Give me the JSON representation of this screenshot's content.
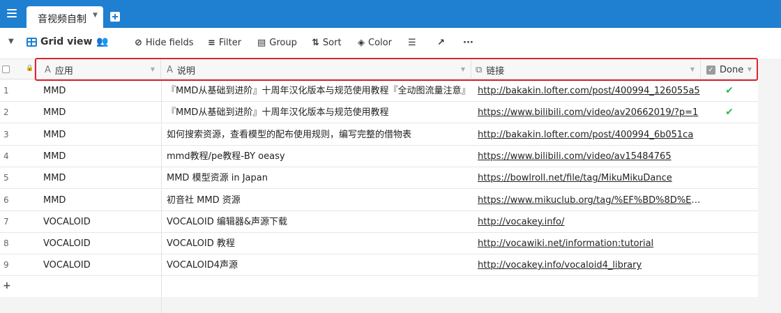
{
  "tab": {
    "title": "音视频自制"
  },
  "toolbar": {
    "view_name": "Grid view",
    "hide_fields": "Hide fields",
    "filter": "Filter",
    "group": "Group",
    "sort": "Sort",
    "color": "Color",
    "more": "···"
  },
  "columns": {
    "app": "应用",
    "desc": "说明",
    "link": "链接",
    "done": "Done"
  },
  "rows": [
    {
      "n": "1",
      "app": "MMD",
      "desc": "『MMD从基础到进阶』十周年汉化版本与规范使用教程『全动图流量注意』",
      "url": "http://bakakin.lofter.com/post/400994_126055a5",
      "done": "✔"
    },
    {
      "n": "2",
      "app": "MMD",
      "desc": "『MMD从基础到进阶』十周年汉化版本与规范使用教程",
      "url": "https://www.bilibili.com/video/av20662019/?p=1",
      "done": "✔"
    },
    {
      "n": "3",
      "app": "MMD",
      "desc": "如何搜索资源，查看模型的配布使用规则，编写完整的借物表",
      "url": "http://bakakin.lofter.com/post/400994_6b051ca",
      "done": ""
    },
    {
      "n": "4",
      "app": "MMD",
      "desc": "mmd教程/pe教程-BY oeasy",
      "url": "https://www.bilibili.com/video/av15484765",
      "done": ""
    },
    {
      "n": "5",
      "app": "MMD",
      "desc": "MMD 模型资源 in Japan",
      "url": "https://bowlroll.net/file/tag/MikuMikuDance",
      "done": ""
    },
    {
      "n": "6",
      "app": "MMD",
      "desc": "初音社 MMD 资源",
      "url": "https://www.mikuclub.org/tag/%EF%BD%8D%EF%BD...",
      "done": ""
    },
    {
      "n": "7",
      "app": "VOCALOID",
      "desc": "VOCALOID 编辑器&声源下载",
      "url": "http://vocakey.info/",
      "done": ""
    },
    {
      "n": "8",
      "app": "VOCALOID",
      "desc": "VOCALOID 教程",
      "url": "http://vocawiki.net/information:tutorial",
      "done": ""
    },
    {
      "n": "9",
      "app": "VOCALOID",
      "desc": "VOCALOID4声源",
      "url": "http://vocakey.info/vocaloid4_library",
      "done": ""
    }
  ],
  "add_row": "+",
  "colors": {
    "accent": "#1f7fd1",
    "done_check": "#2eb84a",
    "highlight": "#e0242c"
  }
}
